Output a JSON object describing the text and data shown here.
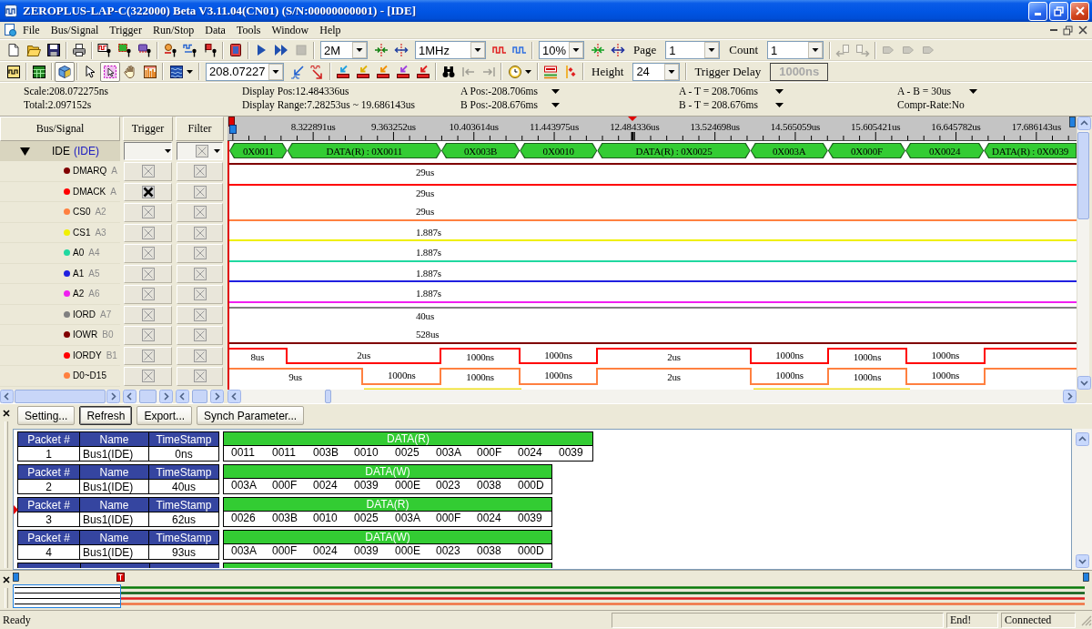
{
  "window": {
    "title": "ZEROPLUS-LAP-C(322000) Beta V3.11.04(CN01) (S/N:00000000001) - [IDE]"
  },
  "menu": [
    "File",
    "Bus/Signal",
    "Trigger",
    "Run/Stop",
    "Data",
    "Tools",
    "Window",
    "Help"
  ],
  "toolbar_1": [
    [
      {
        "kind": "button",
        "disabled": false
      },
      {
        "kind": "button",
        "disabled": false
      },
      {
        "kind": "button",
        "disabled": false
      }
    ],
    [
      {
        "kind": "button",
        "disabled": false
      }
    ],
    [
      {
        "kind": "button",
        "disabled": false
      },
      {
        "kind": "button",
        "disabled": false
      },
      {
        "kind": "button",
        "disabled": false
      }
    ],
    [
      {
        "kind": "button",
        "disabled": false
      },
      {
        "kind": "button",
        "disabled": false
      },
      {
        "kind": "button",
        "disabled": false
      }
    ],
    [
      {
        "kind": "button",
        "disabled": false
      }
    ],
    [
      {
        "kind": "button",
        "disabled": false
      },
      {
        "kind": "button",
        "disabled": false
      },
      {
        "kind": "button",
        "disabled": true
      }
    ],
    [
      {
        "kind": "combo",
        "value": "2M"
      },
      {
        "kind": "button",
        "disabled": false
      },
      {
        "kind": "button",
        "disabled": false
      },
      {
        "kind": "combo",
        "value": "1MHz"
      },
      {
        "kind": "button",
        "disabled": false
      },
      {
        "kind": "button",
        "disabled": false
      }
    ],
    [
      {
        "kind": "combo",
        "value": "10%"
      },
      {
        "kind": "button",
        "disabled": false
      },
      {
        "kind": "button",
        "disabled": false
      },
      {
        "kind": "label",
        "text": "Page"
      },
      {
        "kind": "combo",
        "value": "1"
      },
      {
        "kind": "label",
        "text": "Count"
      },
      {
        "kind": "combo",
        "value": "1"
      }
    ],
    [
      {
        "kind": "button",
        "disabled": true
      },
      {
        "kind": "button",
        "disabled": true
      }
    ],
    [
      {
        "kind": "button",
        "disabled": true
      },
      {
        "kind": "button",
        "disabled": true
      },
      {
        "kind": "button",
        "disabled": true
      }
    ]
  ],
  "toolbar_2": [
    [
      {
        "kind": "button",
        "disabled": false,
        "pressed": false
      }
    ],
    [
      {
        "kind": "button",
        "disabled": false,
        "pressed": false
      }
    ],
    [
      {
        "kind": "button",
        "disabled": false,
        "pressed": true
      }
    ],
    [
      {
        "kind": "button",
        "disabled": false,
        "pressed": false
      },
      {
        "kind": "button",
        "disabled": false,
        "pressed": true
      },
      {
        "kind": "button",
        "disabled": false,
        "pressed": false
      },
      {
        "kind": "button",
        "disabled": false,
        "pressed": false
      }
    ],
    [
      {
        "kind": "split",
        "disabled": false,
        "pressed": false
      }
    ],
    [
      {
        "kind": "combo",
        "value": "208.07227"
      },
      {
        "kind": "button",
        "disabled": false,
        "pressed": false
      },
      {
        "kind": "button",
        "disabled": false,
        "pressed": false
      }
    ],
    [
      {
        "kind": "button",
        "disabled": false,
        "pressed": false
      },
      {
        "kind": "button",
        "disabled": false,
        "pressed": false
      },
      {
        "kind": "button",
        "disabled": false,
        "pressed": false
      },
      {
        "kind": "button",
        "disabled": false,
        "pressed": false
      },
      {
        "kind": "button",
        "disabled": false,
        "pressed": false
      }
    ],
    [
      {
        "kind": "button",
        "disabled": false,
        "pressed": false
      },
      {
        "kind": "button",
        "disabled": true,
        "pressed": false
      },
      {
        "kind": "button",
        "disabled": true,
        "pressed": false
      }
    ],
    [
      {
        "kind": "split",
        "disabled": false,
        "pressed": false
      }
    ],
    [
      {
        "kind": "button",
        "disabled": false,
        "pressed": false
      },
      {
        "kind": "button",
        "disabled": false,
        "pressed": false
      }
    ],
    [
      {
        "kind": "label",
        "text": "Height"
      },
      {
        "kind": "combo",
        "value": "24"
      }
    ],
    [
      {
        "kind": "label",
        "text": "Trigger Delay"
      },
      {
        "kind": "field",
        "value": "1000ns",
        "disabled": true
      }
    ]
  ],
  "info": [
    [
      {
        "text": "Scale:208.072275ns",
        "dropdown": false
      },
      {
        "text": "Display Pos:12.484336us",
        "dropdown": false
      },
      {
        "text": "A Pos:-208.706ms",
        "dropdown": true
      },
      {
        "text": "A - T = 208.706ms",
        "dropdown": true
      },
      {
        "text": "A - B = 30us",
        "dropdown": true
      }
    ],
    [
      {
        "text": "Total:2.097152s",
        "dropdown": false
      },
      {
        "text": "Display Range:7.28253us ~ 19.686143us",
        "dropdown": false
      },
      {
        "text": "B Pos:-208.676ms",
        "dropdown": true
      },
      {
        "text": "B - T = 208.676ms",
        "dropdown": true
      },
      {
        "text": "Compr-Rate:No",
        "dropdown": false
      }
    ]
  ],
  "signal_panel": {
    "columns": [
      "Bus/Signal",
      "Trigger",
      "Filter"
    ],
    "bus": {
      "name": "IDE",
      "alias": "(IDE)",
      "expanded": true
    },
    "signals": [
      {
        "name": "DMARQ",
        "channel": "A",
        "color": "#800000",
        "trigger_active": false,
        "filter_active": false,
        "waveform": [
          {
            "label": "29us",
            "high": true
          }
        ]
      },
      {
        "name": "DMACK",
        "channel": "A",
        "color": "#ff0000",
        "trigger_active": true,
        "filter_active": false,
        "waveform": [
          {
            "label": "29us",
            "high": true
          }
        ]
      },
      {
        "name": "CS0",
        "channel": "A2",
        "color": "#ff8040",
        "trigger_active": false,
        "filter_active": false,
        "waveform": [
          {
            "label": "29us",
            "high": false
          }
        ]
      },
      {
        "name": "CS1",
        "channel": "A3",
        "color": "#f0f000",
        "trigger_active": false,
        "filter_active": false,
        "waveform": [
          {
            "label": "1.887s",
            "high": false
          }
        ]
      },
      {
        "name": "A0",
        "channel": "A4",
        "color": "#20d8a0",
        "trigger_active": false,
        "filter_active": false,
        "waveform": [
          {
            "label": "1.887s",
            "high": false
          }
        ]
      },
      {
        "name": "A1",
        "channel": "A5",
        "color": "#2020e0",
        "trigger_active": false,
        "filter_active": false,
        "waveform": [
          {
            "label": "1.887s",
            "high": false
          }
        ]
      },
      {
        "name": "A2",
        "channel": "A6",
        "color": "#f020f0",
        "trigger_active": false,
        "filter_active": false,
        "waveform": [
          {
            "label": "1.887s",
            "high": false
          }
        ]
      },
      {
        "name": "IORD",
        "channel": "A7",
        "color": "#808080",
        "trigger_active": false,
        "filter_active": false,
        "waveform": [
          {
            "label": "40us",
            "high": true
          }
        ]
      },
      {
        "name": "IOWR",
        "channel": "B0",
        "color": "#800000",
        "trigger_active": false,
        "filter_active": false,
        "waveform": [
          {
            "label": "528us",
            "high": false
          }
        ]
      },
      {
        "name": "IORDY",
        "channel": "B1",
        "color": "#ff0000",
        "trigger_active": false,
        "filter_active": false,
        "waveform": [
          {
            "label": "8us",
            "high": true
          },
          {
            "label": "2us",
            "high": false
          },
          {
            "label": "1000ns",
            "high": true
          },
          {
            "label": "1000ns",
            "high": false
          },
          {
            "label": "2us",
            "high": true
          },
          {
            "label": "1000ns",
            "high": false
          },
          {
            "label": "1000ns",
            "high": true
          },
          {
            "label": "1000ns",
            "high": false
          },
          {
            "high": true
          }
        ]
      },
      {
        "name": "D0~D15",
        "color": "#ff8040",
        "trigger_active": false,
        "filter_active": false,
        "waveform": [
          {
            "label": "9us",
            "high": true
          },
          {
            "label": "1000ns",
            "high": false
          },
          {
            "label": "1000ns",
            "high": true
          },
          {
            "label": "1000ns",
            "high": false
          },
          {
            "label": "2us",
            "high": true
          },
          {
            "label": "1000ns",
            "high": false
          },
          {
            "label": "1000ns",
            "high": true
          },
          {
            "label": "1000ns",
            "high": false
          },
          {
            "high": true
          }
        ]
      }
    ]
  },
  "waveform_view": {
    "ruler": [
      "8.322891us",
      "9.363252us",
      "10.403614us",
      "11.443975us",
      "12.484336us",
      "13.524698us",
      "14.565059us",
      "15.605421us",
      "16.645782us",
      "17.686143us"
    ],
    "bus_decode": [
      "0X0011",
      "DATA(R) : 0X0011",
      "0X003B",
      "0X0010",
      "DATA(R) : 0X0025",
      "0X003A",
      "0X000F",
      "0X0024",
      "DATA(R) : 0X0039"
    ]
  },
  "packet_view": {
    "buttons": [
      {
        "label": "Setting...",
        "focused": false
      },
      {
        "label": "Refresh",
        "focused": true
      },
      {
        "label": "Export...",
        "focused": false
      },
      {
        "label": "Synch Parameter...",
        "focused": false
      }
    ],
    "packets": [
      {
        "headers": [
          "Packet #",
          "Name",
          "TimeStamp"
        ],
        "number": "1",
        "name": "Bus1(IDE)",
        "timestamp": "0ns",
        "data_title": "DATA(R)",
        "data": [
          "0011",
          "0011",
          "003B",
          "0010",
          "0025",
          "003A",
          "000F",
          "0024",
          "0039"
        ],
        "current": false
      },
      {
        "headers": [
          "Packet #",
          "Name",
          "TimeStamp"
        ],
        "number": "2",
        "name": "Bus1(IDE)",
        "timestamp": "40us",
        "data_title": "DATA(W)",
        "data": [
          "003A",
          "000F",
          "0024",
          "0039",
          "000E",
          "0023",
          "0038",
          "000D"
        ],
        "current": false
      },
      {
        "headers": [
          "Packet #",
          "Name",
          "TimeStamp"
        ],
        "number": "3",
        "name": "Bus1(IDE)",
        "timestamp": "62us",
        "data_title": "DATA(R)",
        "data": [
          "0026",
          "003B",
          "0010",
          "0025",
          "003A",
          "000F",
          "0024",
          "0039"
        ],
        "current": true
      },
      {
        "headers": [
          "Packet #",
          "Name",
          "TimeStamp"
        ],
        "number": "4",
        "name": "Bus1(IDE)",
        "timestamp": "93us",
        "data_title": "DATA(W)",
        "data": [
          "003A",
          "000F",
          "0024",
          "0039",
          "000E",
          "0023",
          "0038",
          "000D"
        ],
        "current": false
      }
    ]
  },
  "status": {
    "message": "Ready",
    "panes": [
      "End!",
      "Connected"
    ]
  }
}
